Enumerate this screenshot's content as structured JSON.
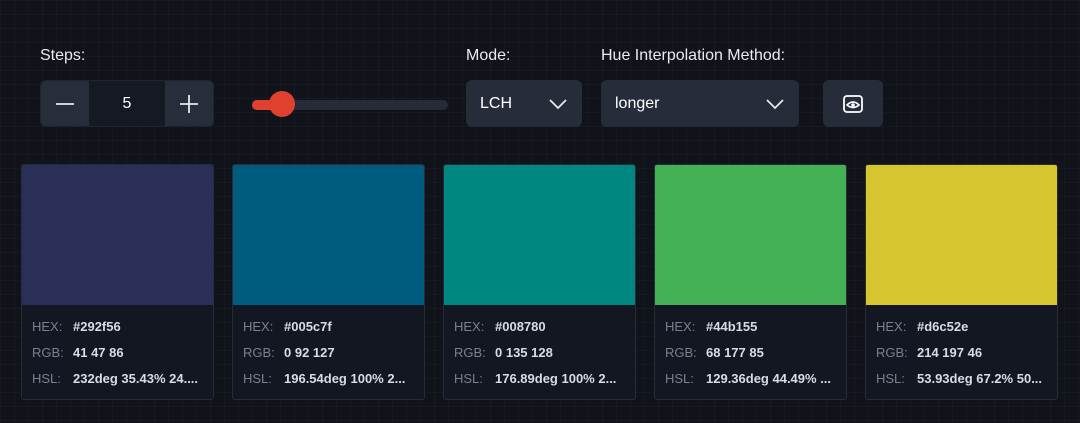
{
  "steps": {
    "label": "Steps:",
    "value": "5",
    "slider_fraction": 0.1
  },
  "mode": {
    "label": "Mode:",
    "selected": "LCH"
  },
  "hue": {
    "label": "Hue Interpolation Method:",
    "selected": "longer"
  },
  "icons": {
    "decrement": "minus-icon",
    "increment": "plus-icon",
    "dropdown": "chevron-down-icon",
    "preview": "eye-icon"
  },
  "colors": {
    "accent": "#e0412f"
  },
  "labels": {
    "hex": "HEX:",
    "rgb": "RGB:",
    "hsl": "HSL:"
  },
  "swatches": [
    {
      "hex": "#292f56",
      "rgb": "41 47 86",
      "hsl": "232deg 35.43% 24...."
    },
    {
      "hex": "#005c7f",
      "rgb": "0 92 127",
      "hsl": "196.54deg 100% 2..."
    },
    {
      "hex": "#008780",
      "rgb": "0 135 128",
      "hsl": "176.89deg 100% 2..."
    },
    {
      "hex": "#44b155",
      "rgb": "68 177 85",
      "hsl": "129.36deg 44.49% ..."
    },
    {
      "hex": "#d6c52e",
      "rgb": "214 197 46",
      "hsl": "53.93deg 67.2% 50..."
    }
  ]
}
